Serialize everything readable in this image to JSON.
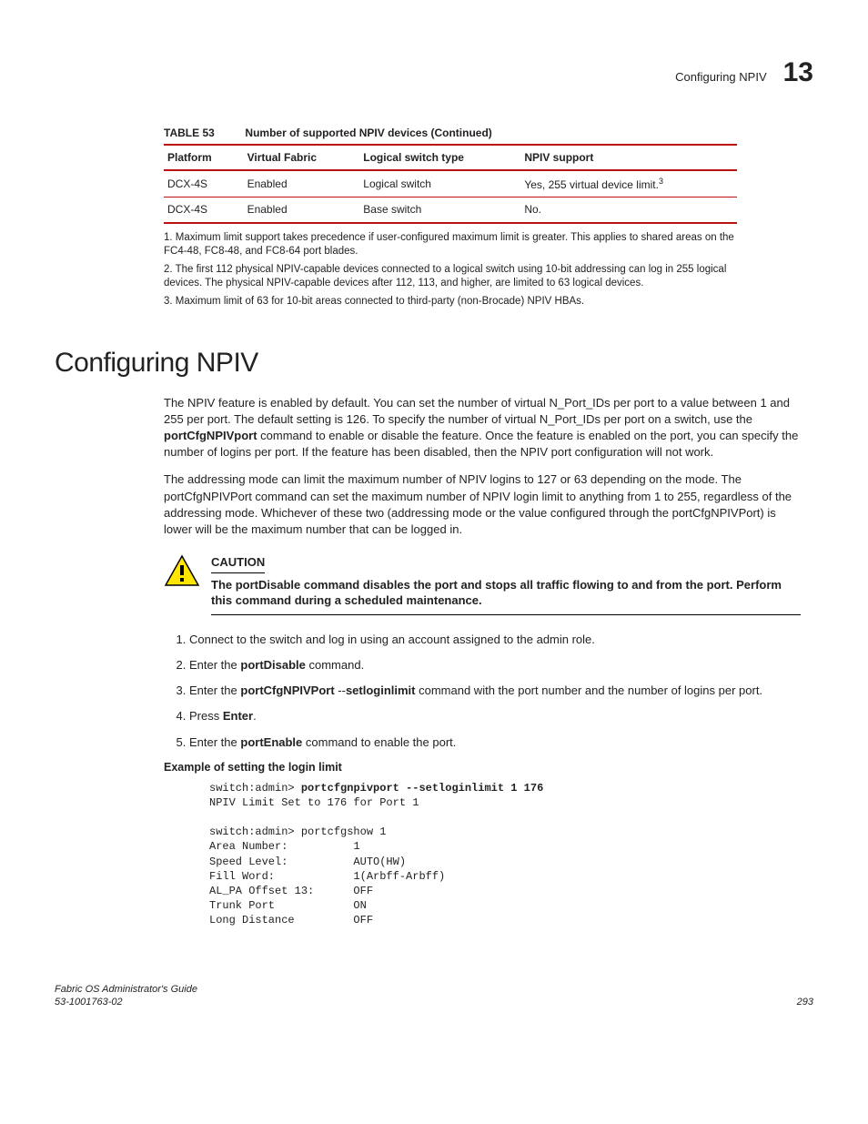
{
  "header": {
    "text": "Configuring NPIV",
    "chapter": "13"
  },
  "table": {
    "label": "TABLE 53",
    "caption": "Number of supported NPIV devices  (Continued)",
    "columns": [
      "Platform",
      "Virtual Fabric",
      "Logical switch type",
      "NPIV support"
    ],
    "rows": [
      {
        "c0": "DCX-4S",
        "c1": "Enabled",
        "c2": "Logical switch",
        "c3": "Yes, 255 virtual device limit.",
        "sup": "3"
      },
      {
        "c0": "DCX-4S",
        "c1": "Enabled",
        "c2": "Base switch",
        "c3": "No.",
        "sup": ""
      }
    ],
    "footnotes": [
      "1.    Maximum limit support takes precedence if user-configured maximum limit is greater. This applies to shared areas on the FC4-48, FC8-48, and FC8-64 port blades.",
      "2.    The first 112 physical NPIV-capable devices connected to a logical switch using 10-bit addressing can log in 255 logical devices. The physical NPIV-capable devices after 112, 113, and higher, are limited to 63 logical devices.",
      "3.    Maximum limit of 63 for 10-bit areas connected to third-party (non-Brocade) NPIV HBAs."
    ]
  },
  "section_title": "Configuring NPIV",
  "para1a": "The NPIV feature is enabled by default. You can set the number of virtual N_Port_IDs per port to a value between 1 and 255 per port. The default setting is 126. To specify the number of virtual N_Port_IDs per port on a switch, use the ",
  "para1bold": "portCfgNPIVport",
  "para1b": " command to enable or disable the feature. Once the feature is enabled on the port, you can specify the number of logins per port. If the feature has been disabled, then the NPIV port configuration will not work.",
  "para2": "The addressing mode can limit the maximum number of NPIV logins to 127 or 63 depending on the mode. The portCfgNPIVPort command can set the maximum number of NPIV login limit to anything from 1 to 255, regardless of the addressing mode. Whichever of these two (addressing mode or the value configured through the portCfgNPIVPort) is lower will be the maximum number that can be logged in.",
  "caution": {
    "label": "CAUTION",
    "body": "The portDisable command disables the port and stops all traffic flowing to and from the port. Perform this command during a scheduled maintenance."
  },
  "steps": {
    "s1": "Connect to the switch and log in using an account assigned to the admin role.",
    "s2a": "Enter the ",
    "s2b": "portDisable",
    "s2c": "  command.",
    "s3a": "Enter the ",
    "s3b": "portCfgNPIVPort",
    "s3c": " --",
    "s3d": "setloginlimit",
    "s3e": " command with the port number and the number of logins per port.",
    "s4a": "Press ",
    "s4b": "Enter",
    "s4c": ".",
    "s5a": "Enter the ",
    "s5b": "portEnable",
    "s5c": " command to enable the port."
  },
  "example_label": "Example  of setting the login limit",
  "code": {
    "l1": "switch:admin> ",
    "l1b": "portcfgnpivport --setloginlimit 1 176",
    "l2": "NPIV Limit Set to 176 for Port 1",
    "l3": "",
    "l4": "switch:admin> portcfgshow 1",
    "l5": "Area Number:          1",
    "l6": "Speed Level:          AUTO(HW)",
    "l7": "Fill Word:            1(Arbff-Arbff)",
    "l8": "AL_PA Offset 13:      OFF",
    "l9": "Trunk Port            ON",
    "l10": "Long Distance         OFF"
  },
  "footer": {
    "left1": "Fabric OS Administrator's Guide",
    "left2": "53-1001763-02",
    "right": "293"
  }
}
